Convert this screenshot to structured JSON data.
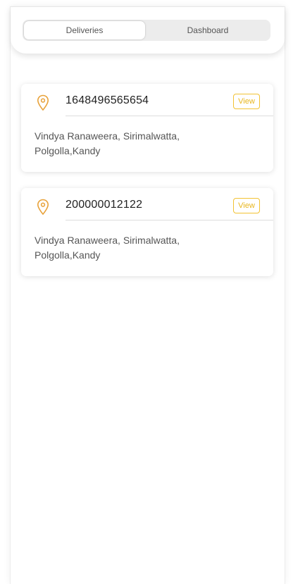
{
  "tabs": {
    "deliveries_label": "Deliveries",
    "dashboard_label": "Dashboard"
  },
  "deliveries": [
    {
      "order_id": "1648496565654",
      "view_label": "View",
      "address": "Vindya Ranaweera, Sirimalwatta, Polgolla,Kandy"
    },
    {
      "order_id": "200000012122",
      "view_label": "View",
      "address": "Vindya Ranaweera, Sirimalwatta, Polgolla,Kandy"
    }
  ],
  "icons": {
    "location": "map-pin-icon"
  },
  "colors": {
    "accent": "#e8a23a",
    "view_button": "#f2c232",
    "tab_bg": "#ececec"
  }
}
